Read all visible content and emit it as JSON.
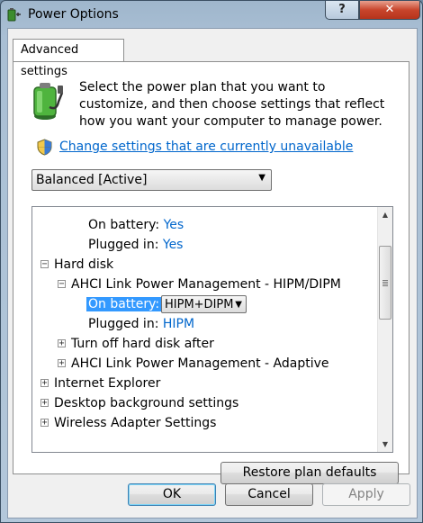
{
  "window": {
    "title": "Power Options",
    "help_label": "?",
    "close_label": "✕"
  },
  "tab": {
    "label": "Advanced settings"
  },
  "intro_text": "Select the power plan that you want to customize, and then choose settings that reflect how you want your computer to manage power.",
  "change_settings_link": "Change settings that are currently unavailable",
  "plan_select": {
    "value": "Balanced [Active]"
  },
  "tree": {
    "on_battery_top": {
      "label": "On battery:",
      "value": "Yes"
    },
    "plugged_in_top": {
      "label": "Plugged in:",
      "value": "Yes"
    },
    "hard_disk": {
      "label": "Hard disk",
      "expander": "−"
    },
    "ahci_hipm": {
      "label": "AHCI Link Power Management - HIPM/DIPM",
      "expander": "−"
    },
    "on_battery_sel": {
      "label": "On battery:",
      "value": "HIPM+DIPM"
    },
    "plugged_in_sel": {
      "label": "Plugged in:",
      "value": "HIPM"
    },
    "turn_off_disk": {
      "label": "Turn off hard disk after",
      "expander": "+"
    },
    "ahci_adaptive": {
      "label": "AHCI Link Power Management - Adaptive",
      "expander": "+"
    },
    "internet_explorer": {
      "label": "Internet Explorer",
      "expander": "+"
    },
    "desktop_bg": {
      "label": "Desktop background settings",
      "expander": "+"
    },
    "wireless": {
      "label": "Wireless Adapter Settings",
      "expander": "+"
    }
  },
  "buttons": {
    "restore": "Restore plan defaults",
    "ok": "OK",
    "cancel": "Cancel",
    "apply": "Apply"
  },
  "colors": {
    "link": "#0066cc",
    "selection": "#3399ff",
    "close": "#c8452c"
  },
  "icons": [
    "power-options-icon",
    "battery-plug-icon",
    "uac-shield-icon",
    "dropdown-arrow-icon",
    "scroll-up-icon",
    "scroll-down-icon"
  ]
}
